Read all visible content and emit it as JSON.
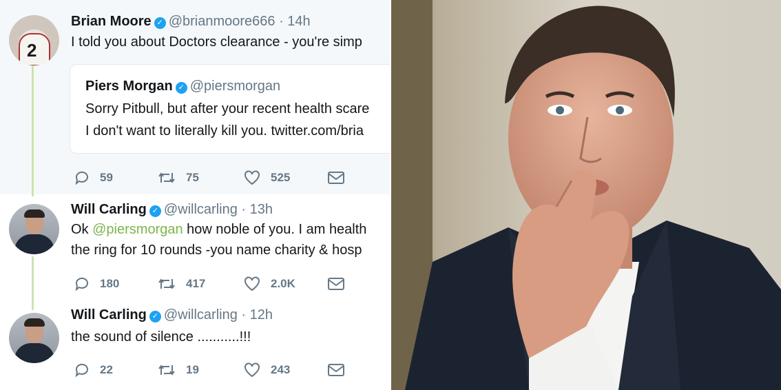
{
  "tweets": [
    {
      "name": "Brian Moore",
      "handle": "@brianmoore666",
      "time": "· 14h",
      "text": "I told you about Doctors clearance - you're simp",
      "avatar_number": "2",
      "quote": {
        "name": "Piers Morgan",
        "handle": "@piersmorgan",
        "line1": "Sorry Pitbull, but after your recent health scare",
        "line2": "I don't want to literally kill you. twitter.com/bria"
      },
      "replies": "59",
      "retweets": "75",
      "likes": "525"
    },
    {
      "name": "Will Carling",
      "handle": "@willcarling",
      "time": "· 13h",
      "text_prefix": "Ok ",
      "mention": "@piersmorgan",
      "text_suffix": " how noble of you. I am health",
      "text_line2": "the ring for 10 rounds -you name charity & hosp",
      "replies": "180",
      "retweets": "417",
      "likes": "2.0K"
    },
    {
      "name": "Will Carling",
      "handle": "@willcarling",
      "time": "· 12h",
      "text": "the sound of silence ...........!!!",
      "replies": "22",
      "retweets": "19",
      "likes": "243"
    }
  ],
  "icons": {
    "verified": "verified-badge-icon",
    "reply": "reply-icon",
    "retweet": "retweet-icon",
    "like": "heart-icon",
    "message": "envelope-icon"
  },
  "colors": {
    "verified": "#1da1f2",
    "mention": "#7bb54c",
    "thread_line": "#c9e5ad",
    "muted": "#657786"
  }
}
